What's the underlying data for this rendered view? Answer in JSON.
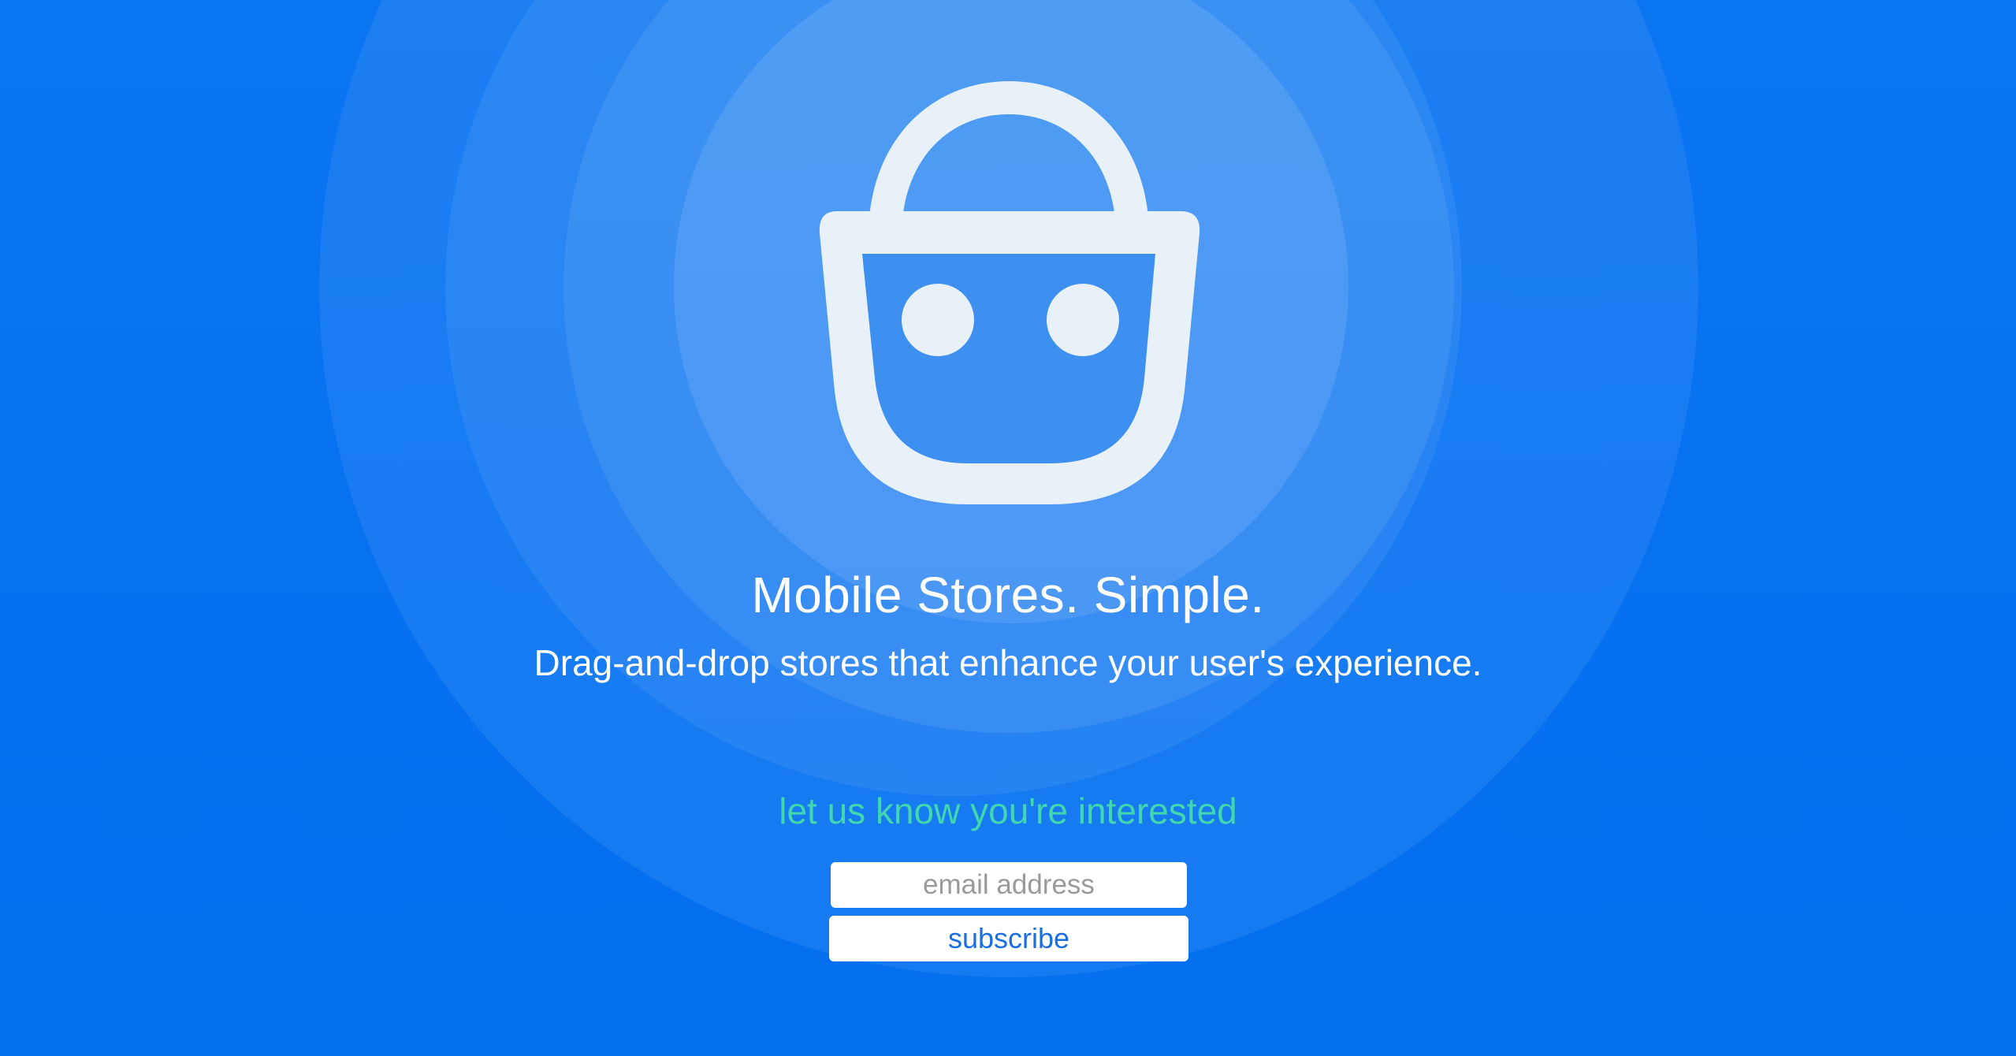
{
  "hero": {
    "logo_icon": "shopping-basket-face-icon",
    "title": "Mobile Stores. Simple.",
    "subtitle": "Drag-and-drop stores that enhance your user's experience."
  },
  "signup": {
    "prompt": "let us know you're interested",
    "email_placeholder": "email address",
    "email_value": "",
    "subscribe_label": "subscribe"
  },
  "colors": {
    "background": "#0572f0",
    "accent_text": "#3fd6b0",
    "logo": "#e8f0f8",
    "button_text": "#1a6fe0"
  }
}
